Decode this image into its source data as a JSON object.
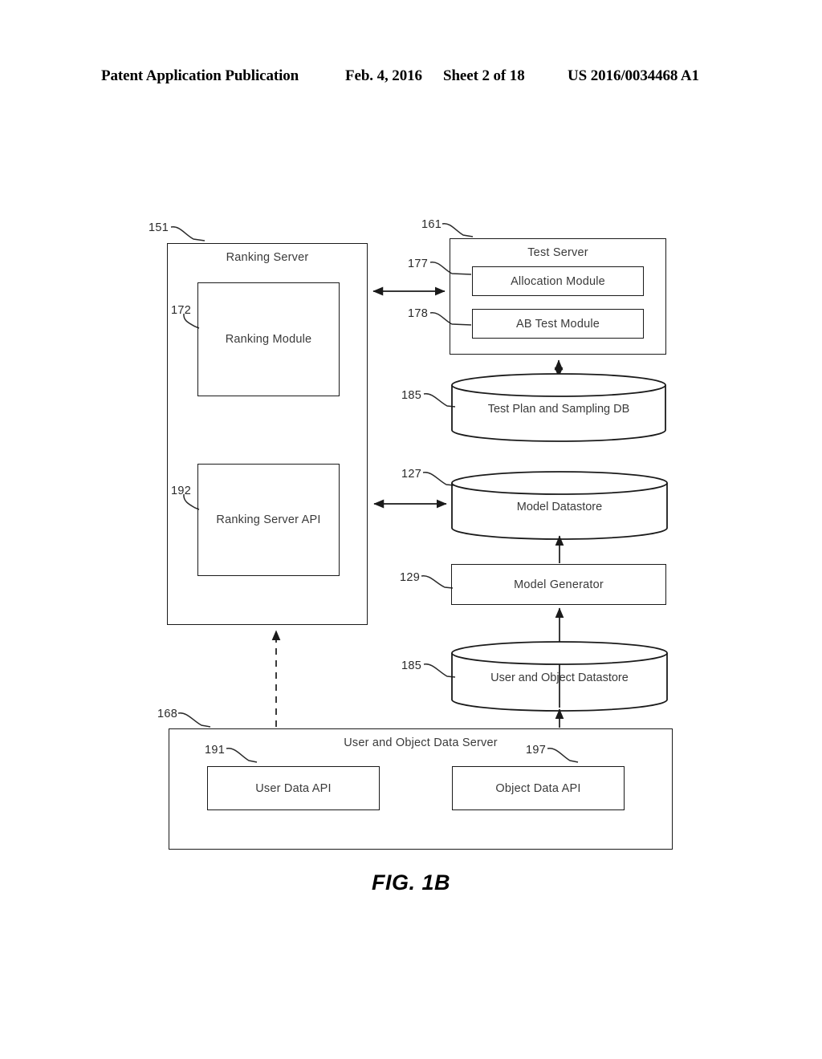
{
  "header": {
    "publication": "Patent Application Publication",
    "date": "Feb. 4, 2016",
    "sheet": "Sheet 2 of 18",
    "patent_number": "US 2016/0034468 A1"
  },
  "figure": {
    "caption": "FIG. 1B"
  },
  "diagram": {
    "blocks": {
      "ranking_server": {
        "label": "Ranking Server",
        "ref": "151"
      },
      "ranking_module": {
        "label": "Ranking Module",
        "ref": "172"
      },
      "ranking_server_api": {
        "label": "Ranking Server API",
        "ref": "192"
      },
      "test_server": {
        "label": "Test Server",
        "ref": "161"
      },
      "allocation_module": {
        "label": "Allocation Module",
        "ref": "177"
      },
      "ab_test_module": {
        "label": "AB Test Module",
        "ref": "178"
      },
      "test_plan_db": {
        "label": "Test Plan and Sampling DB",
        "ref": "185"
      },
      "model_datastore": {
        "label": "Model Datastore",
        "ref": "127"
      },
      "model_generator": {
        "label": "Model Generator",
        "ref": "129"
      },
      "user_object_datastore": {
        "label": "User and Object Datastore",
        "ref": "185"
      },
      "user_object_data_server": {
        "label": "User and Object Data Server",
        "ref": "168"
      },
      "user_data_api": {
        "label": "User Data API",
        "ref": "191"
      },
      "object_data_api": {
        "label": "Object Data API",
        "ref": "197"
      }
    },
    "connections": [
      {
        "from": "ranking_server",
        "to": "test_server",
        "style": "solid",
        "arrows": "both"
      },
      {
        "from": "test_plan_db",
        "to": "test_server",
        "style": "solid",
        "arrows": "both"
      },
      {
        "from": "ranking_server_api",
        "to": "model_datastore",
        "style": "solid",
        "arrows": "both"
      },
      {
        "from": "model_generator",
        "to": "model_datastore",
        "style": "solid",
        "arrows": "up"
      },
      {
        "from": "user_object_datastore",
        "to": "model_generator",
        "style": "solid",
        "arrows": "up"
      },
      {
        "from": "user_object_data_server",
        "to": "user_object_datastore",
        "style": "solid",
        "arrows": "up"
      },
      {
        "from": "user_object_data_server",
        "to": "ranking_server",
        "style": "dashed",
        "arrows": "up"
      }
    ],
    "colors": {
      "line": "#1a1a1a",
      "text": "#3a3a3a",
      "background": "#ffffff"
    }
  }
}
